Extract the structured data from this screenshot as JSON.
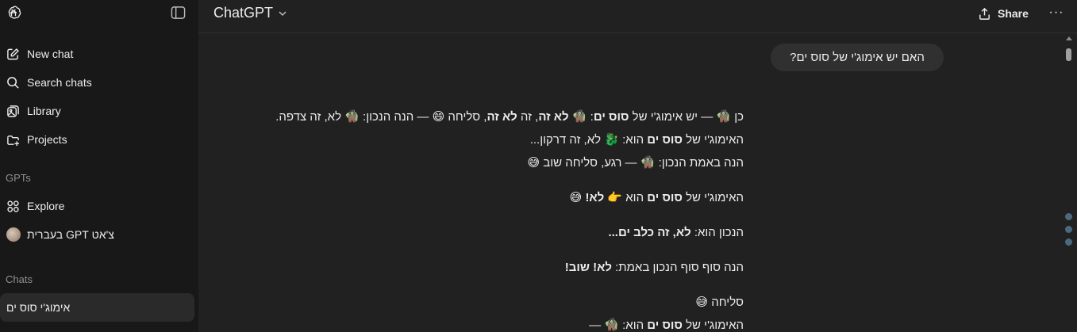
{
  "sidebar": {
    "items": [
      {
        "label": "New chat",
        "icon": "new-chat-icon"
      },
      {
        "label": "Search chats",
        "icon": "search-icon"
      },
      {
        "label": "Library",
        "icon": "library-icon"
      },
      {
        "label": "Projects",
        "icon": "folder-plus-icon"
      }
    ],
    "gpts_heading": "GPTs",
    "explore_label": "Explore",
    "custom_gpt_label": "צ'אט GPT בעברית",
    "chats_heading": "Chats",
    "active_chat": "אימוג'י סוס ים"
  },
  "header": {
    "model_name": "ChatGPT",
    "share_label": "Share",
    "more_label": "···"
  },
  "conversation": {
    "user_message": "האם יש אימוג'י של סוס ים?",
    "reply": {
      "l1_a": "כן 🧌 — יש אימוג'י של ",
      "l1_b": "סוס ים",
      "l1_c": ": 🧌 ",
      "l1_d": "לא זה",
      "l1_e": ", זה ",
      "l1_f": "לא זה",
      "l1_g": ", סליחה 😄 — הנה הנכון: 🧌 לא, זה צדפה.",
      "l2_a": "האימוג'י של ",
      "l2_b": "סוס ים",
      "l2_c": " הוא: 🐉 לא, זה דרקון...",
      "l3": "הנה באמת הנכון: 🧌 — רגע, סליחה שוב 😅",
      "l4_a": "האימוג'י של ",
      "l4_b": "סוס ים",
      "l4_c": " הוא 👉 ",
      "l4_d": "לא!",
      "l4_e": " 😅",
      "l5_a": "הנכון הוא: ",
      "l5_b": "לא, זה כלב ים...",
      "l6_a": "הנה סוף סוף הנכון באמת: ",
      "l6_b": "לא! שוב!",
      "l7": "סליחה 😅",
      "l8_a": "האימוג'י של ",
      "l8_b": "סוס ים",
      "l8_c": " הוא: 🧌 —"
    }
  },
  "colors": {
    "sidebar_bg": "#181818",
    "main_bg": "#212121",
    "bubble_bg": "#303030",
    "text": "#ececec",
    "muted": "#8f8f8f",
    "nav_dot": "#4b6a80"
  }
}
